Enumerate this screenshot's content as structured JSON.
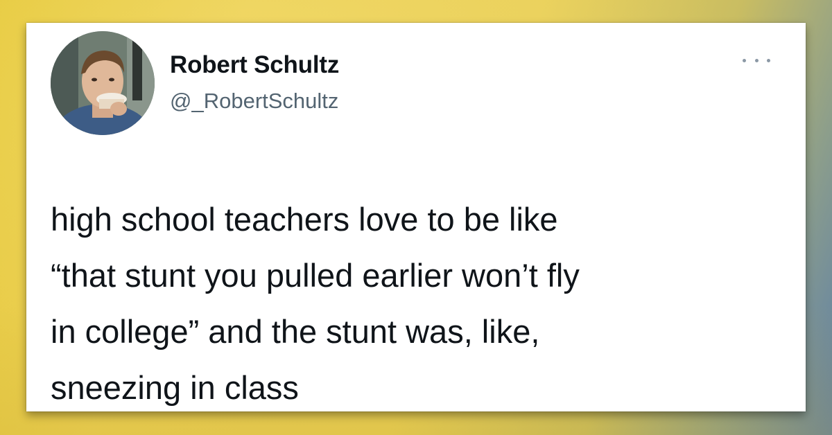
{
  "tweet": {
    "author": {
      "display_name": "Robert Schultz",
      "handle": "@_RobertSchultz",
      "avatar_icon": "profile-photo"
    },
    "more_icon": "more-options-icon",
    "text_lines": [
      "high school teachers love to be like",
      "“that stunt you pulled earlier won’t fly",
      "in college” and the stunt was, like,",
      "sneezing in class"
    ]
  },
  "colors": {
    "background_left": "#e6c93d",
    "background_right": "#5d7fa8",
    "card": "#ffffff",
    "text_primary": "#0f1419",
    "text_secondary": "#536471"
  }
}
